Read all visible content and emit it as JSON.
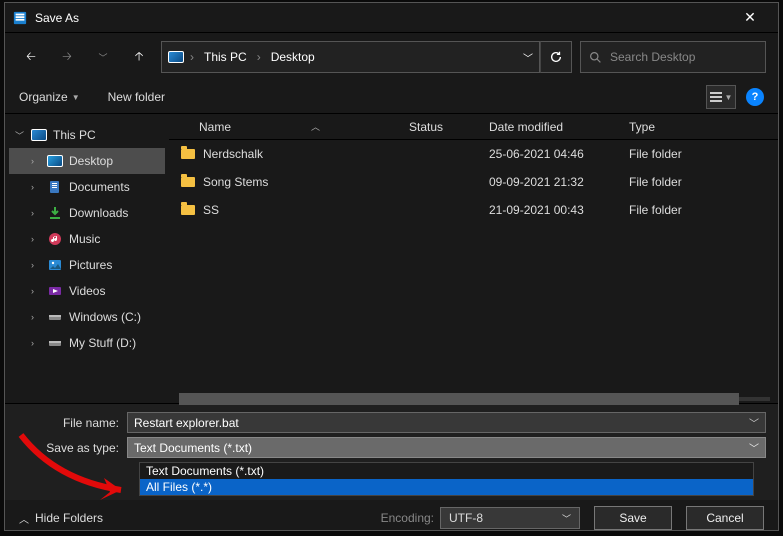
{
  "window": {
    "title": "Save As"
  },
  "nav": {
    "crumb1": "This PC",
    "crumb2": "Desktop",
    "search_placeholder": "Search Desktop"
  },
  "toolbar": {
    "organize": "Organize",
    "newfolder": "New folder"
  },
  "tree": {
    "root": "This PC",
    "items": [
      {
        "label": "Desktop"
      },
      {
        "label": "Documents"
      },
      {
        "label": "Downloads"
      },
      {
        "label": "Music"
      },
      {
        "label": "Pictures"
      },
      {
        "label": "Videos"
      },
      {
        "label": "Windows (C:)"
      },
      {
        "label": "My Stuff (D:)"
      }
    ]
  },
  "columns": {
    "name": "Name",
    "status": "Status",
    "date": "Date modified",
    "type": "Type"
  },
  "rows": [
    {
      "name": "Nerdschalk",
      "date": "25-06-2021 04:46",
      "type": "File folder"
    },
    {
      "name": "Song Stems",
      "date": "09-09-2021 21:32",
      "type": "File folder"
    },
    {
      "name": "SS",
      "date": "21-09-2021 00:43",
      "type": "File folder"
    }
  ],
  "fields": {
    "filename_label": "File name:",
    "filename_value": "Restart explorer.bat",
    "savetype_label": "Save as type:",
    "savetype_value": "Text Documents (*.txt)",
    "options": [
      "Text Documents (*.txt)",
      "All Files  (*.*)"
    ]
  },
  "footer": {
    "hidefolders": "Hide Folders",
    "encoding_label": "Encoding:",
    "encoding_value": "UTF-8",
    "save": "Save",
    "cancel": "Cancel"
  }
}
